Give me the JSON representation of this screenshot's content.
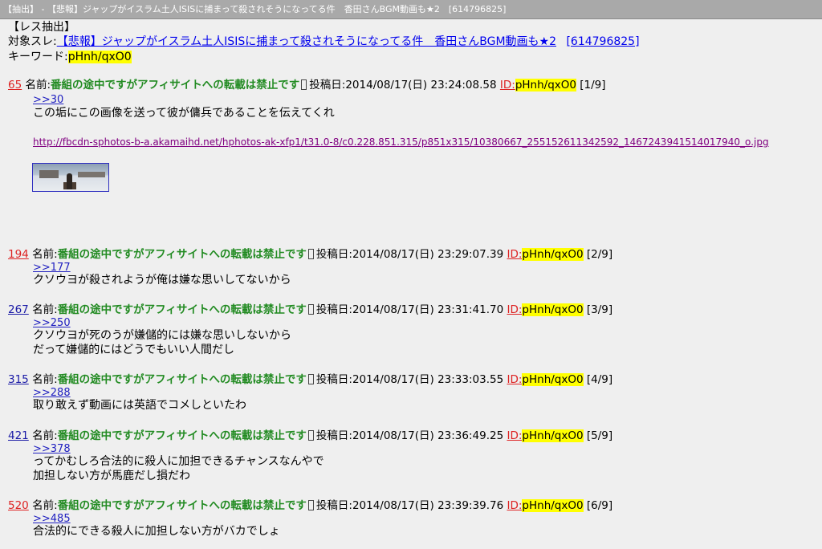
{
  "window": {
    "title": "【抽出】 - 【悲報】ジャップがイスラム土人ISISに捕まって殺されそうになってる件　香田さんBGM動画も★2　[614796825]"
  },
  "header": {
    "heading": "【レス抽出】",
    "thread_label": "対象スレ:",
    "thread_title": "【悲報】ジャップがイスラム土人ISISに捕まって殺されそうになってる件　香田さんBGM動画も★2",
    "thread_id": "[614796825]",
    "keyword_label": "キーワード:",
    "keyword": "pHnh/qxO0"
  },
  "labels": {
    "name_label": "名前:",
    "post_name": "番組の途中ですがアフィサイトへの転載は禁止です",
    "date_label": "投稿日:",
    "id_label": "ID:"
  },
  "posts": [
    {
      "number": "65",
      "datetime": "2014/08/17(日) 23:24:08.58",
      "id": "pHnh/qxO0",
      "count": "[1/9]",
      "reply": ">>30",
      "lines": [
        "この垢にこの画像を送って彼が傭兵であることを伝えてくれ"
      ],
      "url": "http://fbcdn-sphotos-b-a.akamaihd.net/hphotos-ak-xfp1/t31.0-8/c0.228.851.315/p851x315/10380667_255152611342592_1467243941514017940_o.jpg"
    },
    {
      "number": "194",
      "datetime": "2014/08/17(日) 23:29:07.39",
      "id": "pHnh/qxO0",
      "count": "[2/9]",
      "reply": ">>177",
      "lines": [
        "クソウヨが殺されようが俺は嫌な思いしてないから"
      ]
    },
    {
      "number": "267",
      "datetime": "2014/08/17(日) 23:31:41.70",
      "id": "pHnh/qxO0",
      "count": "[3/9]",
      "reply": ">>250",
      "lines": [
        "クソウヨが死のうが嫌儲的には嫌な思いしないから",
        "だって嫌儲的にはどうでもいい人間だし"
      ]
    },
    {
      "number": "315",
      "datetime": "2014/08/17(日) 23:33:03.55",
      "id": "pHnh/qxO0",
      "count": "[4/9]",
      "reply": ">>288",
      "lines": [
        "取り敢えず動画には英語でコメしといたわ"
      ]
    },
    {
      "number": "421",
      "datetime": "2014/08/17(日) 23:36:49.25",
      "id": "pHnh/qxO0",
      "count": "[5/9]",
      "reply": ">>378",
      "lines": [
        "ってかむしろ合法的に殺人に加担できるチャンスなんやで",
        "加担しない方が馬鹿だし損だわ"
      ]
    },
    {
      "number": "520",
      "datetime": "2014/08/17(日) 23:39:39.76",
      "id": "pHnh/qxO0",
      "count": "[6/9]",
      "reply": ">>485",
      "lines": [
        "合法的にできる殺人に加担しない方がバカでしょ"
      ]
    }
  ]
}
